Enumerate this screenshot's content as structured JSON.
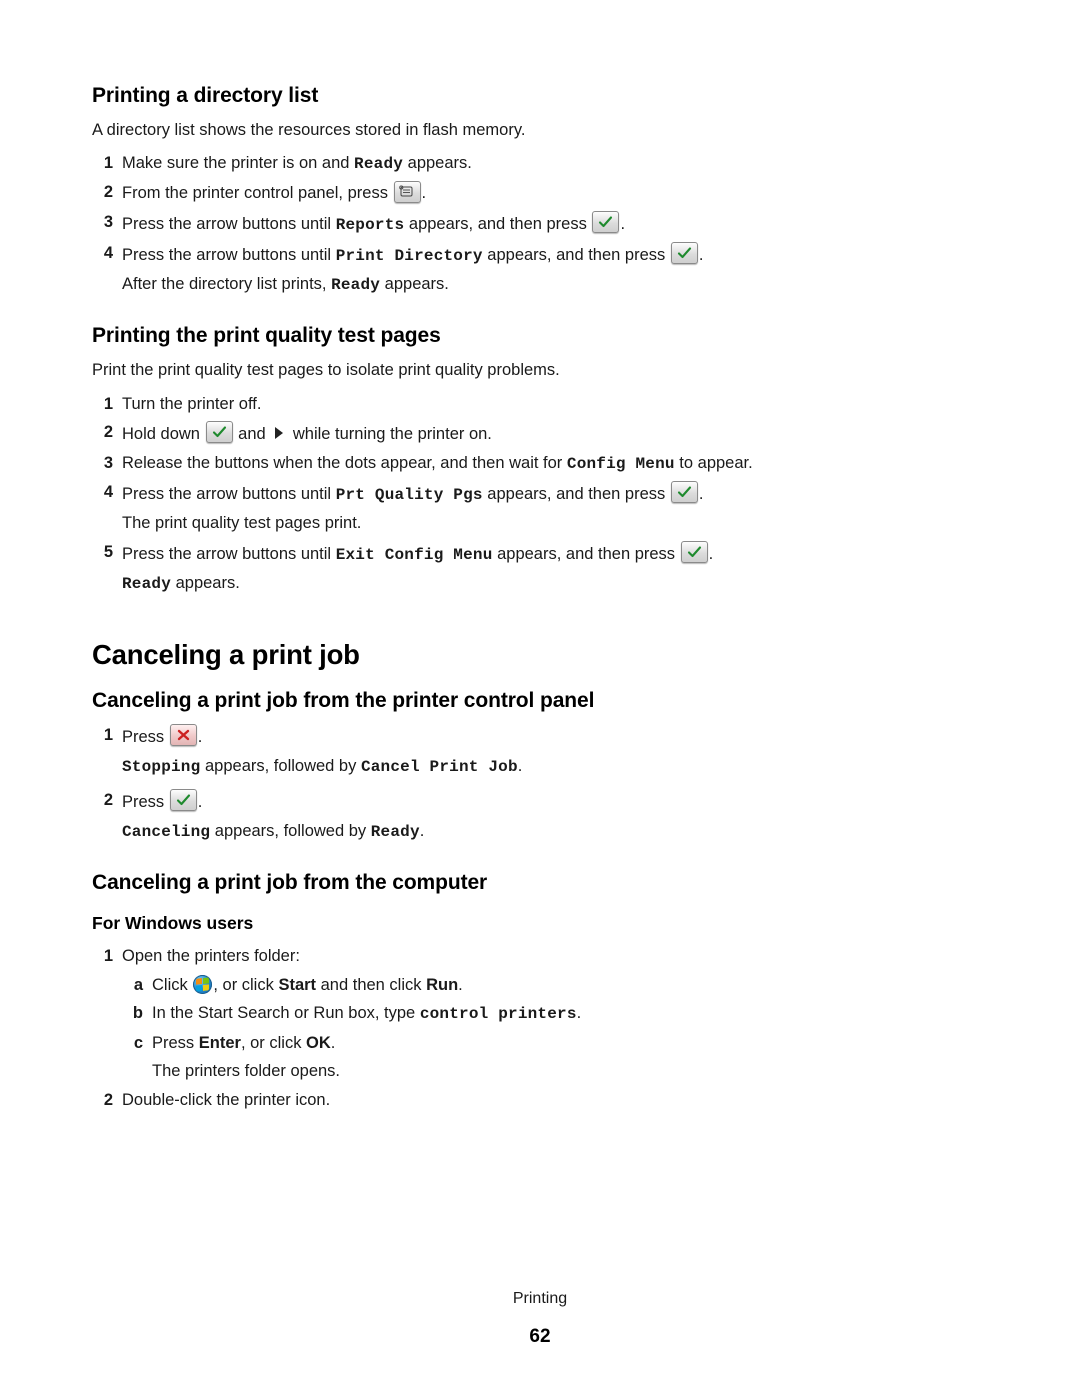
{
  "document": {
    "footer_label": "Printing",
    "page_number": "62"
  },
  "sections": {
    "directory_list": {
      "heading": "Printing a directory list",
      "intro": "A directory list shows the resources stored in flash memory.",
      "steps": [
        {
          "num": "1",
          "pre": "Make sure the printer is on and ",
          "mono": "Ready",
          "post": " appears."
        },
        {
          "num": "2",
          "pre": "From the printer control panel, press ",
          "icon": "menu-key-icon",
          "post": "."
        },
        {
          "num": "3",
          "pre": "Press the arrow buttons until ",
          "mono": "Reports",
          "mid": " appears, and then press ",
          "icon": "select-check-key-icon",
          "post": "."
        },
        {
          "num": "4",
          "pre": "Press the arrow buttons until ",
          "mono": "Print Directory",
          "mid": " appears, and then press ",
          "icon": "select-check-key-icon",
          "post": "."
        }
      ],
      "after_note_pre": "After the directory list prints, ",
      "after_note_mono": "Ready",
      "after_note_post": " appears."
    },
    "quality_test": {
      "heading": "Printing the print quality test pages",
      "intro": "Print the print quality test pages to isolate print quality problems.",
      "step1": "Turn the printer off.",
      "step2_pre": "Hold down ",
      "step2_mid": " and ",
      "step2_post": " while turning the printer on.",
      "step3_pre": "Release the buttons when the dots appear, and then wait for ",
      "step3_mono": "Config Menu",
      "step3_post": " to appear.",
      "step4_pre": "Press the arrow buttons until ",
      "step4_mono": "Prt Quality Pgs",
      "step4_mid": " appears, and then press ",
      "step4_post": ".",
      "step4_note": "The print quality test pages print.",
      "step5_pre": "Press the arrow buttons until ",
      "step5_mono": "Exit Config Menu",
      "step5_mid": " appears, and then press ",
      "step5_post": ".",
      "step5_note_mono": "Ready",
      "step5_note_post": " appears."
    },
    "canceling": {
      "heading": "Canceling a print job",
      "control_panel": {
        "heading": "Canceling a print job from the printer control panel",
        "step1_pre": "Press ",
        "step1_post": ".",
        "step1_note_mono1": "Stopping",
        "step1_note_mid": " appears, followed by ",
        "step1_note_mono2": "Cancel Print Job",
        "step1_note_post": ".",
        "step2_pre": "Press ",
        "step2_post": ".",
        "step2_note_mono1": "Canceling",
        "step2_note_mid": " appears, followed by ",
        "step2_note_mono2": "Ready",
        "step2_note_post": "."
      },
      "computer": {
        "heading": "Canceling a print job from the computer",
        "windows_heading": "For Windows users",
        "step1": "Open the printers folder:",
        "step1a_pre": "Click ",
        "step1a_mid": ", or click ",
        "step1a_bold1": "Start",
        "step1a_mid2": " and then click ",
        "step1a_bold2": "Run",
        "step1a_post": ".",
        "step1b_pre": "In the Start Search or Run box, type ",
        "step1b_mono": "control printers",
        "step1b_post": ".",
        "step1c_pre": "Press ",
        "step1c_bold1": "Enter",
        "step1c_mid": ", or click ",
        "step1c_bold2": "OK",
        "step1c_post": ".",
        "step1c_note": "The printers folder opens.",
        "step2": "Double-click the printer icon."
      }
    }
  },
  "icons": {
    "menu_key": "menu-key-icon",
    "select_check": "select-check-key-icon",
    "cancel_cross": "cancel-cross-key-icon",
    "right_arrow": "right-arrow-icon",
    "windows_start": "windows-start-orb-icon"
  },
  "colors": {
    "check_green": "#1f8a2e",
    "cross_red": "#cc2222",
    "text": "#1a1a1a"
  }
}
